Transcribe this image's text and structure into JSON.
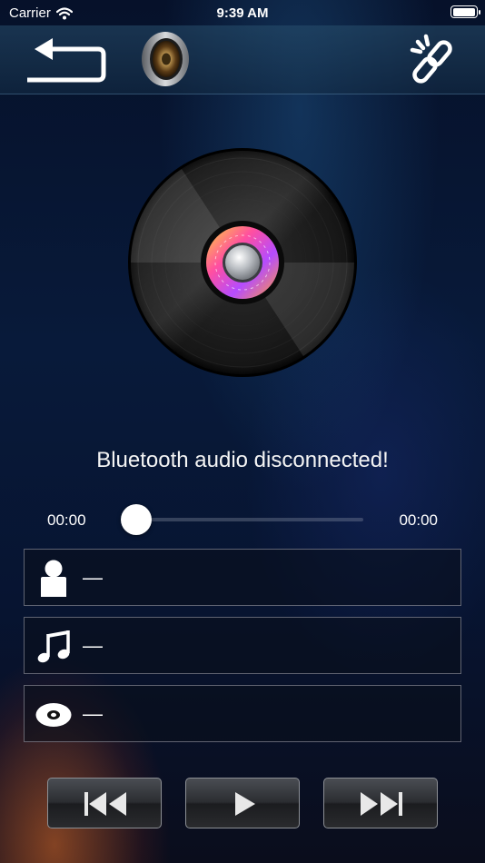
{
  "status_bar": {
    "carrier": "Carrier",
    "time": "9:39 AM",
    "battery_level": 1.0
  },
  "top_bar": {
    "back_icon": "return-arrow-icon",
    "speaker_icon": "speaker-icon",
    "link_icon": "broken-link-icon"
  },
  "player": {
    "status_message": "Bluetooth audio disconnected!",
    "elapsed": "00:00",
    "total": "00:00",
    "progress": 0
  },
  "track_info": {
    "artist": "—",
    "title": "—",
    "album": "—"
  },
  "controls": {
    "previous_icon": "previous-track-icon",
    "play_icon": "play-icon",
    "next_icon": "next-track-icon"
  },
  "colors": {
    "background": "#081a3a",
    "accent_glow": "#e66e28",
    "text": "#ffffff"
  }
}
